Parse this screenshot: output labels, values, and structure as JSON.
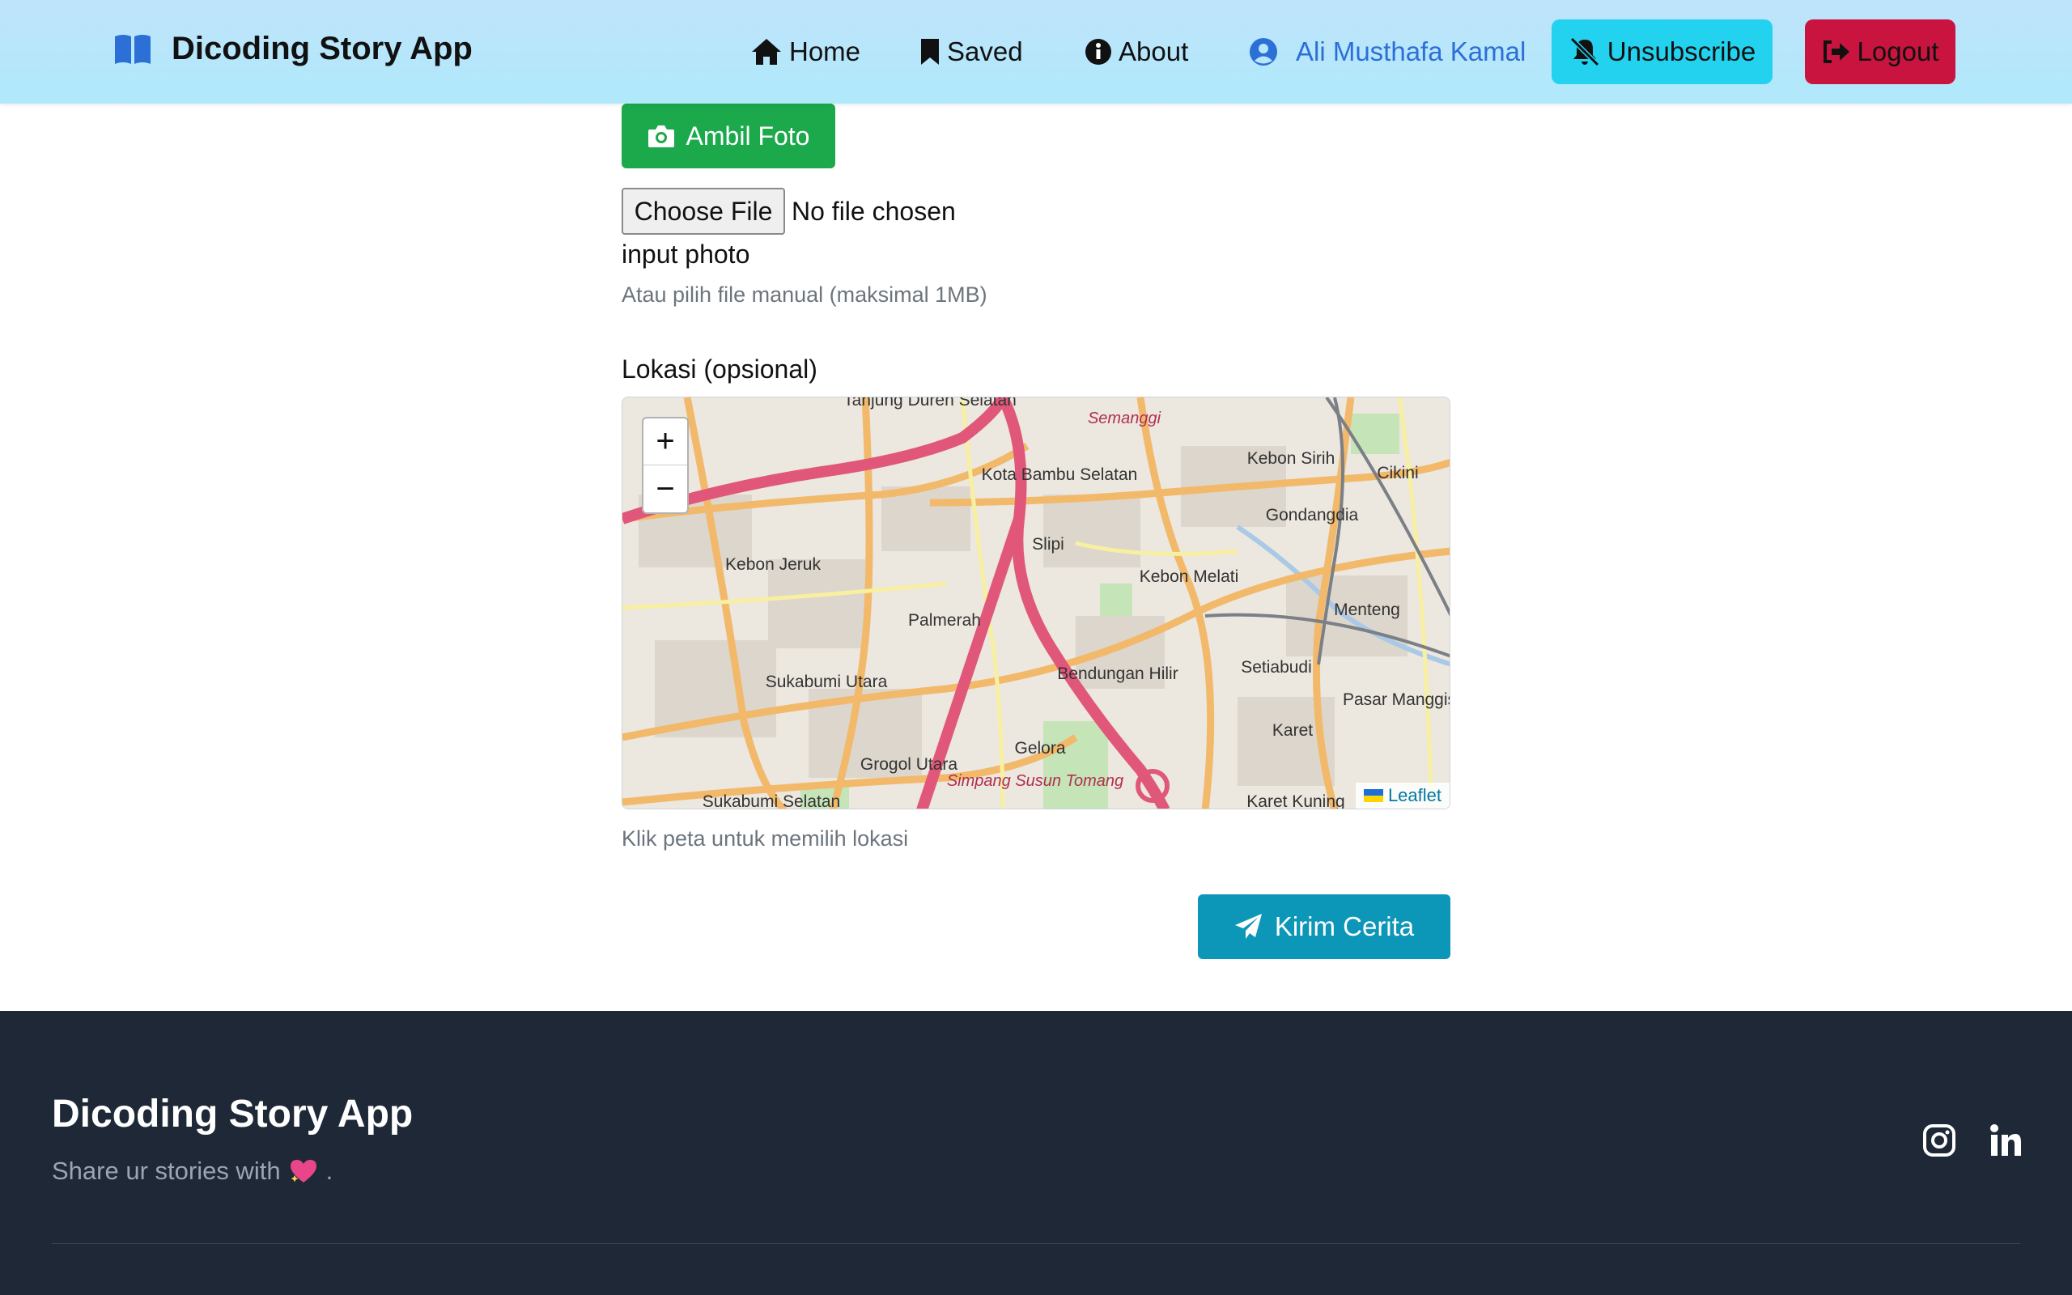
{
  "header": {
    "brand_title": "Dicoding Story App",
    "brand_icon": "book-open-icon",
    "nav": [
      {
        "label": "Home",
        "icon": "home-icon"
      },
      {
        "label": "Saved",
        "icon": "bookmark-icon"
      },
      {
        "label": "About",
        "icon": "info-circle-icon"
      }
    ],
    "user_name": "Ali Musthafa Kamal",
    "unsubscribe_label": "Unsubscribe",
    "logout_label": "Logout"
  },
  "form": {
    "take_photo_label": "Ambil Foto",
    "file_button_label": "Choose File",
    "file_status": "No file chosen",
    "photo_label": "input photo",
    "photo_hint": "Atau pilih file manual (maksimal 1MB)",
    "location_label": "Lokasi (opsional)",
    "map_hint": "Klik peta untuk memilih lokasi",
    "submit_label": "Kirim Cerita"
  },
  "map": {
    "zoom_in": "+",
    "zoom_out": "−",
    "attribution": "Leaflet",
    "places": [
      "Tanjung Duren Selatan",
      "Simpang Susun Tomang",
      "Kota Bambu Selatan",
      "Kebon Sirih",
      "Gondangdia",
      "Cikini",
      "Slipi",
      "Kebon Melati",
      "Menteng",
      "Kebon Jeruk",
      "Palmerah",
      "Sukabumi Utara",
      "Bendungan Hilir",
      "Setiabudi",
      "Pasar Manggis",
      "Karet",
      "Gelora",
      "Semanggi",
      "Grogol Utara",
      "Sukabumi Selatan",
      "Karet Kuning"
    ]
  },
  "footer": {
    "title": "Dicoding Story App",
    "tagline": "Share ur stories with",
    "tagline_end": "."
  },
  "colors": {
    "header_bg": "#b8e6fb",
    "unsubscribe_bg": "#22d2ef",
    "logout_bg": "#c8143f",
    "photo_btn_bg": "#1ba94c",
    "submit_btn_bg": "#0c96b8",
    "footer_bg": "#1e2836"
  }
}
